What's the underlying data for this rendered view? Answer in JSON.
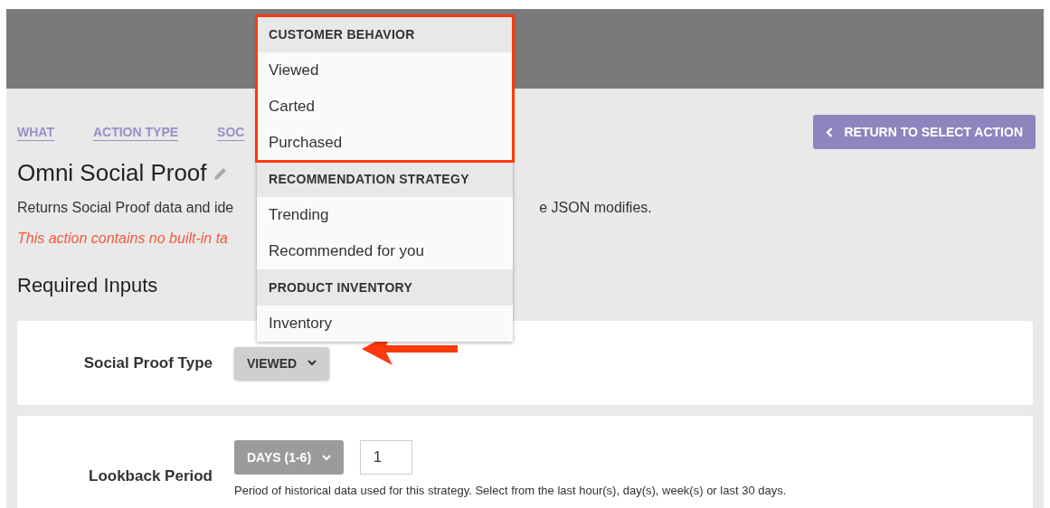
{
  "breadcrumbs": [
    {
      "label": "WHAT"
    },
    {
      "label": "ACTION TYPE"
    },
    {
      "label": "SOC"
    }
  ],
  "return_button": {
    "label": "RETURN TO SELECT ACTION"
  },
  "title": "Omni Social Proof",
  "description": {
    "before": "Returns Social Proof data and ide",
    "after": "e JSON modifies."
  },
  "warning": "This action contains no built-in ta",
  "section_title": "Required Inputs",
  "inputs": [
    {
      "kind": "dropdown",
      "label": "Social Proof Type",
      "value": "VIEWED",
      "disabled": false,
      "annotated": true
    },
    {
      "kind": "dropdown-number",
      "label": "Lookback Period",
      "value": "DAYS (1-6)",
      "disabled": true,
      "annotated": false,
      "number": "1",
      "hint": "Period of historical data used for this strategy. Select from the last hour(s), day(s), week(s) or last 30 days."
    }
  ],
  "dropdown_menu": {
    "groups": [
      {
        "header": "CUSTOMER BEHAVIOR",
        "highlighted": true,
        "items": [
          "Viewed",
          "Carted",
          "Purchased"
        ]
      },
      {
        "header": "RECOMMENDATION STRATEGY",
        "highlighted": false,
        "items": [
          "Trending",
          "Recommended for you"
        ]
      },
      {
        "header": "PRODUCT INVENTORY",
        "highlighted": false,
        "items": [
          "Inventory"
        ]
      }
    ]
  }
}
